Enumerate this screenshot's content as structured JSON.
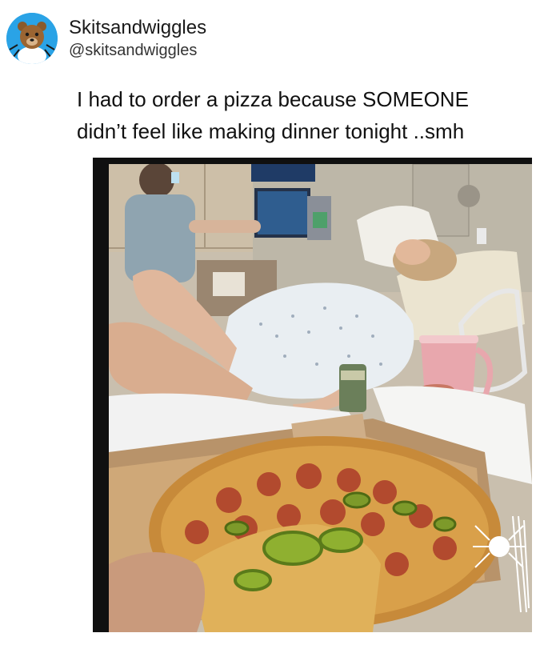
{
  "tweet": {
    "display_name": "Skitsandwiggles",
    "handle": "@skitsandwiggles",
    "text_line_1": "I had to order a pizza because SOMEONE",
    "text_line_2": "didn’t feel like making dinner tonight ..smh"
  },
  "avatar": {
    "background": "#2aa3e6",
    "icon": "bear-mascot-icon"
  },
  "photo": {
    "scene": "hospital-room-pizza-photo",
    "watermark_icon": "spider-logo-icon"
  }
}
